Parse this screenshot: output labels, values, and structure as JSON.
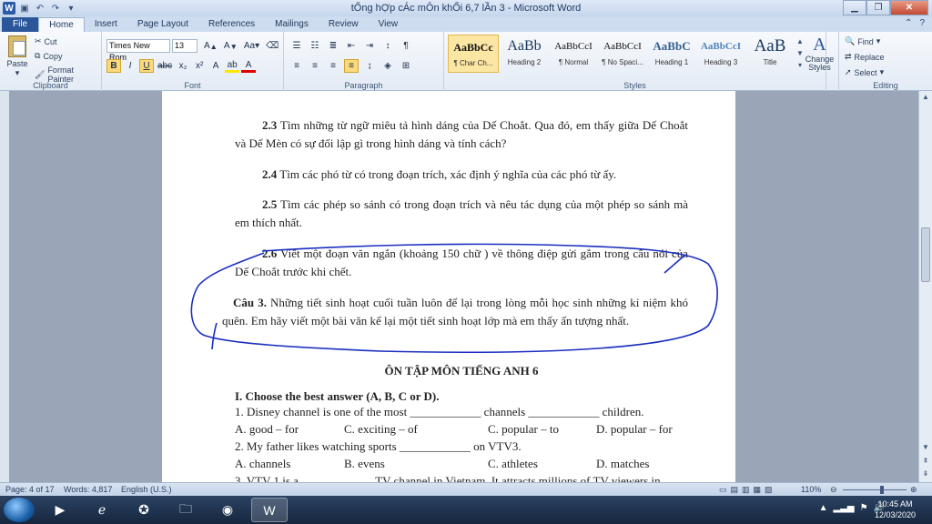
{
  "window": {
    "title": "tỔng hỢp cÁc mÔn  khỐi 6,7 lẦn 3  -  Microsoft Word"
  },
  "tabs": [
    "File",
    "Home",
    "Insert",
    "Page Layout",
    "References",
    "Mailings",
    "Review",
    "View"
  ],
  "ribbon": {
    "clipboard": {
      "label": "Clipboard",
      "paste": "Paste",
      "cut": "Cut",
      "copy": "Copy",
      "format_painter": "Format Painter"
    },
    "font": {
      "label": "Font",
      "family": "Times New Rom",
      "size": "13"
    },
    "paragraph": {
      "label": "Paragraph"
    },
    "styles": {
      "label": "Styles",
      "items": [
        {
          "sample": "AaBbCc",
          "name": "¶ Char Ch..."
        },
        {
          "sample": "AaBb",
          "name": "Heading 2"
        },
        {
          "sample": "AaBbCcI",
          "name": "¶ Normal"
        },
        {
          "sample": "AaBbCcI",
          "name": "¶ No Spaci..."
        },
        {
          "sample": "AaBbC",
          "name": "Heading 1"
        },
        {
          "sample": "AaBbCcI",
          "name": "Heading 3"
        },
        {
          "sample": "AaB",
          "name": "Title"
        }
      ],
      "change_styles": "Change Styles"
    },
    "editing": {
      "label": "Editing",
      "find": "Find",
      "replace": "Replace",
      "select": "Select"
    }
  },
  "document": {
    "p1_num": "2.3",
    "p1_text": " Tìm những từ ngữ miêu tả hình dáng của Dế Choắt. Qua đó, em thấy giữa Dế Choắt và Dế Mèn có sự đối lập gì trong hình dáng và tính cách?",
    "p2_num": "2.4",
    "p2_text": " Tìm các phó từ có trong đoạn trích, xác định ý nghĩa của các phó từ ấy.",
    "p3_num": "2.5",
    "p3_text": " Tìm các phép so sánh có trong đoạn trích và nêu tác dụng của một phép so sánh mà em thích nhất.",
    "p4_num": "2.6",
    "p4_text": " Viết một đoạn văn ngắn (khoảng 150 chữ ) về thông điệp gửi gắm trong câu nói của Dế Choắt trước khi chết.",
    "p5_num": "Câu 3.",
    "p5_text": " Những tiết sinh hoạt cuối tuần luôn để lại trong lòng mỗi học sinh những kỉ niệm khó quên. Em hãy viết một bài văn kể lại một tiết sinh hoạt lớp mà em thấy ấn tượng nhất.",
    "heading": "ÔN TẬP MÔN TIẾNG ANH 6",
    "section": "I. Choose the best answer (A, B, C or D).",
    "q1": "1. Disney channel is one of the most ____________ channels ____________ children.",
    "q1_opts": [
      "A. good – for",
      "C. exciting – of",
      "C. popular – to",
      "D. popular – for"
    ],
    "q2": "2. My father likes watching sports ____________ on VTV3.",
    "q2_opts": [
      "A. channels",
      "B. evens",
      "C. athletes",
      "D. matches"
    ],
    "q3": "3. VTV 1 is a ____________ TV channel in Vietnam. It attracts millions of TV viewers in"
  },
  "status": {
    "page": "Page: 4 of 17",
    "words": "Words: 4,817",
    "language": "English (U.S.)",
    "zoom": "110%"
  },
  "taskbar": {
    "time": "10:45 AM",
    "date": "12/03/2020"
  }
}
